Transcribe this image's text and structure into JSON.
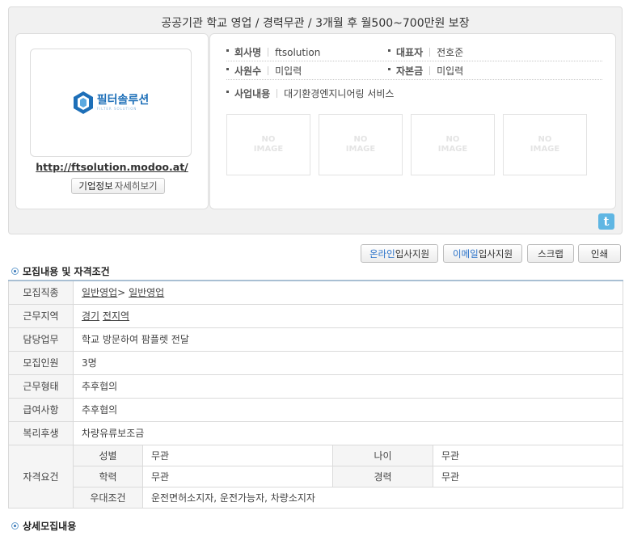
{
  "job_title": "공공기관 학교 영업 / 경력무관 / 3개월 후 월500~700만원 보장",
  "company": {
    "logo_text_ko": "필터솔루션",
    "logo_text_en": "FILTER SOLUTION",
    "url": "http://ftsolution.modoo.at/",
    "detail_button_bold": "기업정보",
    "detail_button_rest": "자세히보기",
    "info": {
      "name_label": "회사명",
      "name_value": "ftsolution",
      "ceo_label": "대표자",
      "ceo_value": "전호준",
      "employees_label": "사원수",
      "employees_value": "미입력",
      "capital_label": "자본금",
      "capital_value": "미입력",
      "business_label": "사업내용",
      "business_value": "대기환경엔지니어링 서비스"
    },
    "no_image_text": [
      "NO\nIMAGE",
      "NO\nIMAGE",
      "NO\nIMAGE",
      "NO\nIMAGE"
    ]
  },
  "share": {
    "twitter_glyph": "t"
  },
  "actions": {
    "online_hl": "온라인",
    "online_rest": "입사지원",
    "email_hl": "이메일",
    "email_rest": "입사지원",
    "scrap": "스크랩",
    "print": "인쇄"
  },
  "sections": {
    "recruit": "모집내용 및 자격조건",
    "detail": "상세모집내용"
  },
  "recruit_table": {
    "job_type_label": "모집직종",
    "job_type_a": "일반영업",
    "job_type_sep": ">",
    "job_type_b": "일반영업",
    "region_label": "근무지역",
    "region_a": "경기",
    "region_b": "전지역",
    "duty_label": "담당업무",
    "duty_value": "학교 방문하여 팜플렛 전달",
    "headcount_label": "모집인원",
    "headcount_value": "3명",
    "work_type_label": "근무형태",
    "work_type_value": "추후협의",
    "salary_label": "급여사항",
    "salary_value": "추후협의",
    "welfare_label": "복리후생",
    "welfare_value": "차량유류보조금",
    "qualification_label": "자격요건",
    "gender_label": "성별",
    "gender_value": "무관",
    "age_label": "나이",
    "age_value": "무관",
    "education_label": "학력",
    "education_value": "무관",
    "career_label": "경력",
    "career_value": "무관",
    "preference_label": "우대조건",
    "preference_value": "운전면허소지자, 운전가능자, 차량소지자"
  },
  "colors": {
    "accent_blue": "#2a72c9",
    "logo_blue": "#1d6fb8",
    "table_top_border": "#a9bfd3",
    "twitter": "#5fb6e3"
  }
}
